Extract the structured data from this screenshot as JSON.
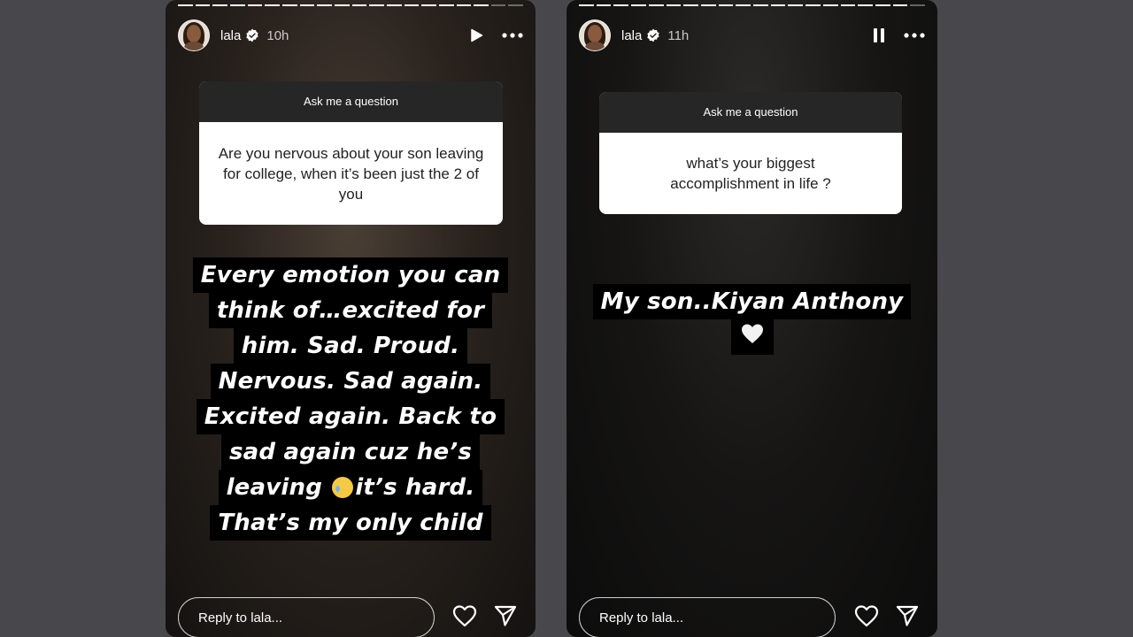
{
  "stories": [
    {
      "username": "lala",
      "time": "10h",
      "question_header": "Ask me a question",
      "question": "Are you nervous about your son leaving for college, when it’s been just the 2 of you",
      "answer_lines": [
        "Every emotion you can",
        "think of…excited for",
        "him. Sad. Proud.",
        "Nervous. Sad again.",
        "Excited again. Back to",
        "sad again cuz he’s",
        "leaving",
        "it’s hard.",
        "That’s my only child"
      ],
      "reply_placeholder": "Reply to lala...",
      "playback_state": "paused-play-icon",
      "progress": {
        "segments": 20,
        "completed": 18
      }
    },
    {
      "username": "lala",
      "time": "11h",
      "question_header": "Ask me a question",
      "question": "what’s your biggest accomplishment in life ?",
      "answer_lines": [
        "My son..Kiyan Anthony"
      ],
      "answer_emoji": "white-heart",
      "reply_placeholder": "Reply to lala...",
      "playback_state": "playing-pause-icon",
      "progress": {
        "segments": 20,
        "completed": 19
      }
    }
  ],
  "colors": {
    "page_bg": "#48484c",
    "card_header_bg": "#262626",
    "text_white": "#ffffff"
  }
}
